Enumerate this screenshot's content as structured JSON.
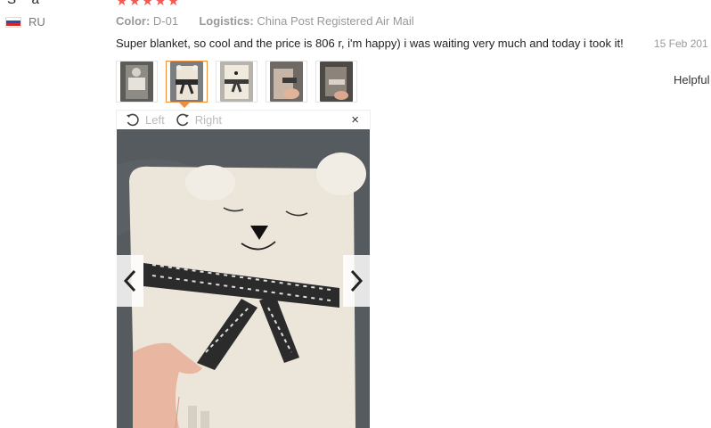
{
  "reviewer": {
    "name": "S***a",
    "country_code": "RU",
    "flag_colors": [
      "#ffffff",
      "#2050b8",
      "#d52b1e"
    ]
  },
  "rating": {
    "stars": 5,
    "star_color": "#f25a55"
  },
  "meta": {
    "color_label": "Color:",
    "color_value": "D-01",
    "logistics_label": "Logistics:",
    "logistics_value": "China Post Registered Air Mail"
  },
  "review": {
    "text": "Super blanket, so cool and the price is 806 r, i'm happy) i was waiting very much and today i took it!",
    "date": "15 Feb 201"
  },
  "helpful_label": "Helpful",
  "thumbnails": [
    {
      "name": "thumbnail-1",
      "active": false,
      "color": "#6c6a64"
    },
    {
      "name": "thumbnail-2",
      "active": true,
      "color": "#d8cfbd"
    },
    {
      "name": "thumbnail-3",
      "active": false,
      "color": "#cfc9bf"
    },
    {
      "name": "thumbnail-4",
      "active": false,
      "color": "#8a7a6f"
    },
    {
      "name": "thumbnail-5",
      "active": false,
      "color": "#6a635c"
    }
  ],
  "viewer": {
    "rotate_left_label": "Left",
    "rotate_right_label": "Right",
    "close_glyph": "×",
    "prev_glyph": "‹",
    "next_glyph": "›"
  },
  "accent_color": "#f08e3a"
}
